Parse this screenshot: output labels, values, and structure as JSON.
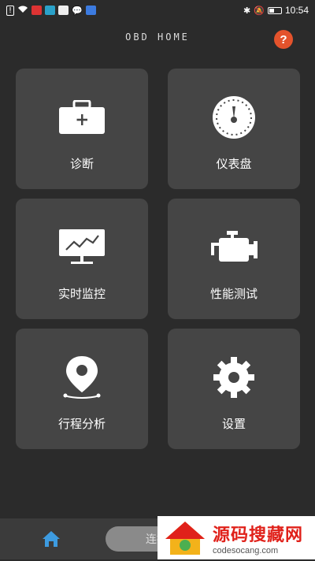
{
  "status_bar": {
    "time": "10:54"
  },
  "header": {
    "title": "OBD HOME",
    "help_label": "?"
  },
  "tiles": [
    {
      "label": "诊断",
      "icon": "toolbox-icon"
    },
    {
      "label": "仪表盘",
      "icon": "gauge-icon"
    },
    {
      "label": "实时监控",
      "icon": "monitor-chart-icon"
    },
    {
      "label": "性能测试",
      "icon": "engine-icon"
    },
    {
      "label": "行程分析",
      "icon": "location-pin-icon"
    },
    {
      "label": "设置",
      "icon": "gear-icon"
    }
  ],
  "bottom_bar": {
    "connect_label": "连接"
  },
  "watermark": {
    "text": "源码搜藏网",
    "url": "codesocang.com"
  },
  "colors": {
    "background": "#2b2b2b",
    "tile": "#454545",
    "accent": "#e4532c"
  }
}
